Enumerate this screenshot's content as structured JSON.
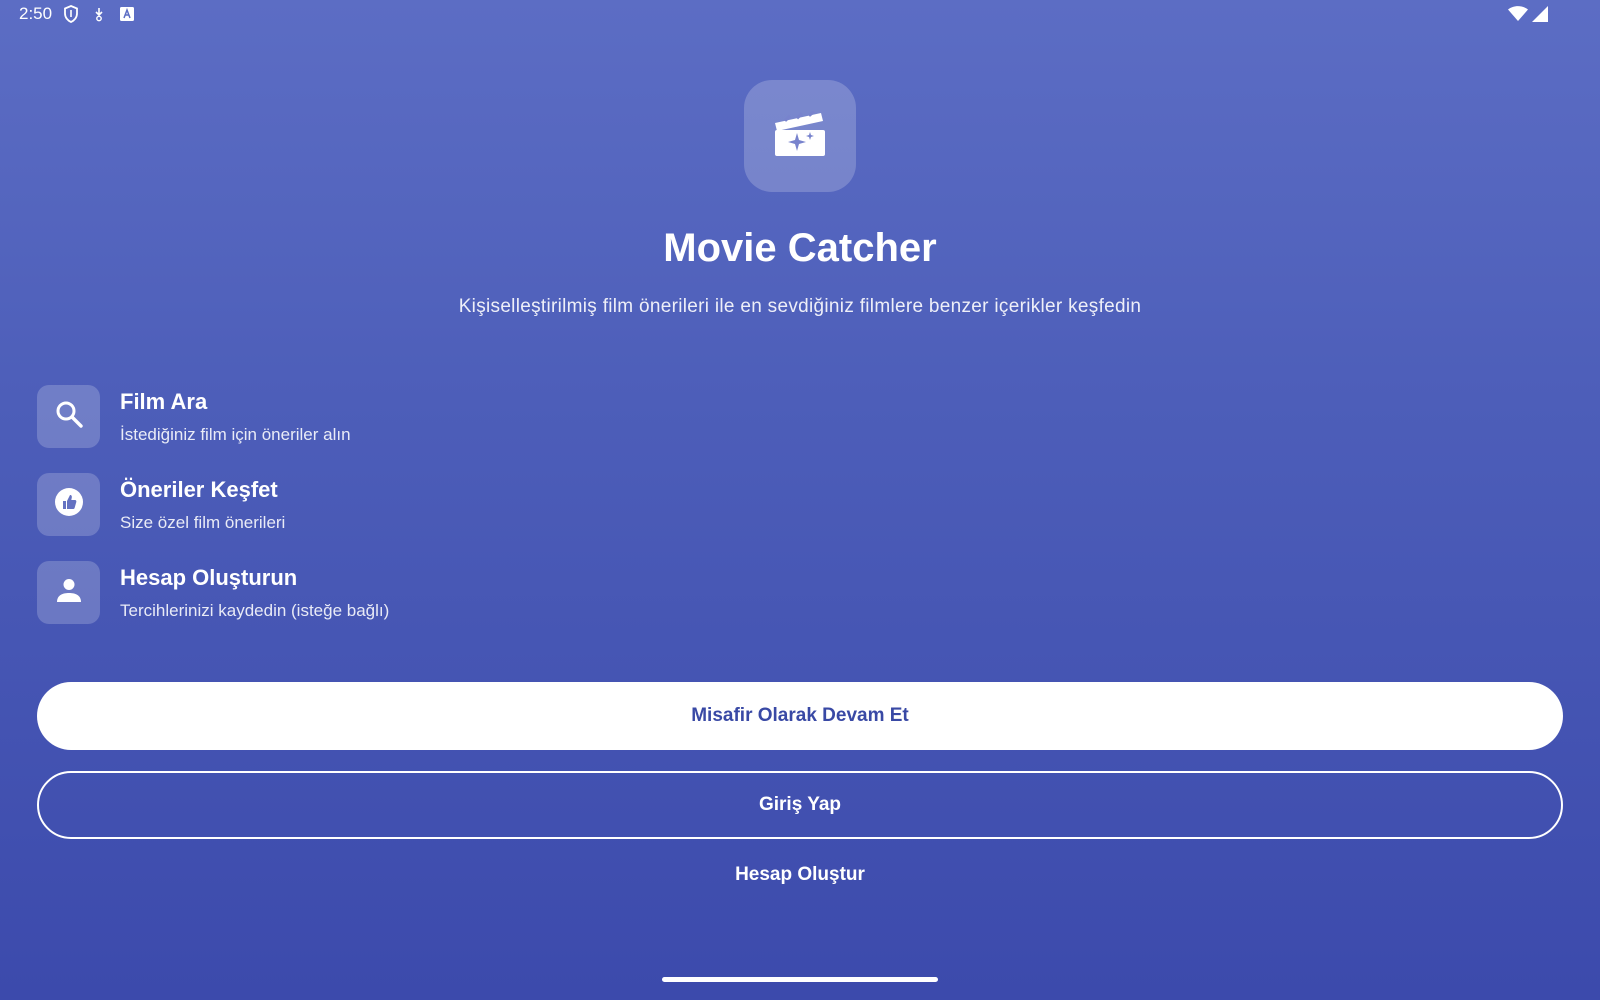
{
  "status_bar": {
    "time": "2:50",
    "left_icons": [
      "shield-icon",
      "download-icon",
      "font-icon"
    ],
    "right_icons": [
      "wifi-icon",
      "signal-icon"
    ]
  },
  "header": {
    "logo_icon": "movie-sparkle-icon",
    "title": "Movie Catcher",
    "subtitle": "Kişiselleştirilmiş film önerileri ile en sevdiğiniz filmlere benzer içerikler keşfedin"
  },
  "features": [
    {
      "icon": "search-icon",
      "title": "Film Ara",
      "description": "İstediğiniz film için öneriler alın"
    },
    {
      "icon": "thumbs-up-icon",
      "title": "Öneriler Keşfet",
      "description": "Size özel film önerileri"
    },
    {
      "icon": "person-icon",
      "title": "Hesap Oluşturun",
      "description": "Tercihlerinizi kaydedin (isteğe bağlı)"
    }
  ],
  "actions": {
    "guest_label": "Misafir Olarak Devam Et",
    "login_label": "Giriş Yap",
    "register_label": "Hesap Oluştur"
  },
  "colors": {
    "gradient_top": "#5c6dc4",
    "gradient_bottom": "#3c4aac",
    "primary_button_text": "#3949a5",
    "white": "#ffffff"
  }
}
